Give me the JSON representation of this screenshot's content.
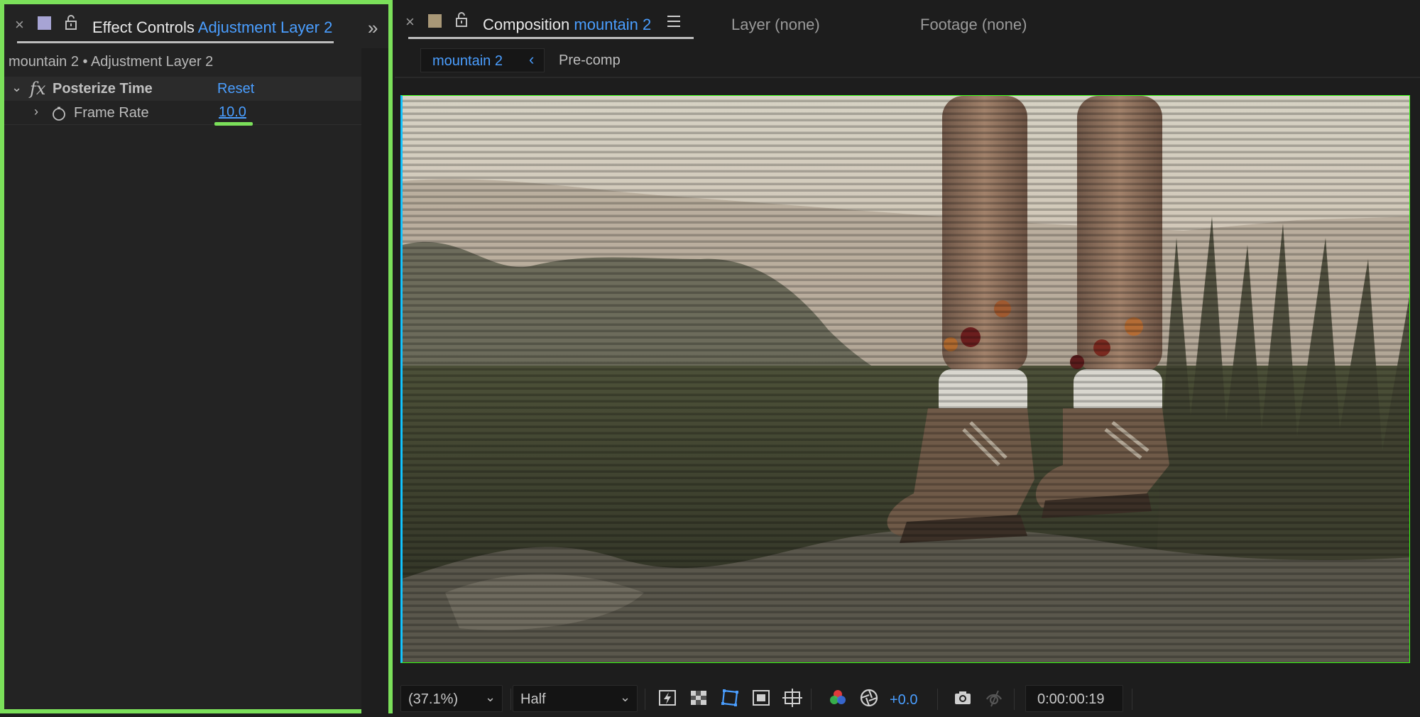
{
  "effect_controls": {
    "tab_label": "Effect Controls",
    "tab_layer": "Adjustment Layer 2",
    "breadcrumb": "mountain 2 • Adjustment Layer 2",
    "effect": {
      "fx_symbol": "fx",
      "name": "Posterize Time",
      "reset_label": "Reset",
      "property": {
        "name": "Frame Rate",
        "value": "10.0"
      }
    }
  },
  "composition": {
    "tab_label": "Composition",
    "comp_name": "mountain 2",
    "layer_tab": "Layer (none)",
    "footage_tab": "Footage (none)",
    "flowchart": {
      "current": "mountain 2",
      "next": "Pre-comp"
    },
    "toolbar": {
      "zoom": "(37.1%)",
      "resolution": "Half",
      "exposure": "+0.0",
      "timecode": "0:00:00:19"
    }
  },
  "icons": {
    "close": "close-icon",
    "lock": "lock-icon",
    "expand": "chevron-double-right-icon",
    "menu": "hamburger-menu-icon",
    "stopwatch": "stopwatch-icon",
    "fast_previews": "fast-previews-icon",
    "transparency_grid": "transparency-grid-icon",
    "mask_visibility": "mask-visibility-icon",
    "region_of_interest": "region-of-interest-icon",
    "guides": "guides-icon",
    "channel": "color-channels-icon",
    "color_management": "aperture-icon",
    "snapshot": "camera-icon",
    "show_snapshot": "show-snapshot-icon"
  },
  "colors": {
    "accent_blue": "#4a9eff",
    "highlight_green": "#7be05a",
    "ec_swatch": "#a7a4d4",
    "comp_swatch": "#a99877"
  }
}
